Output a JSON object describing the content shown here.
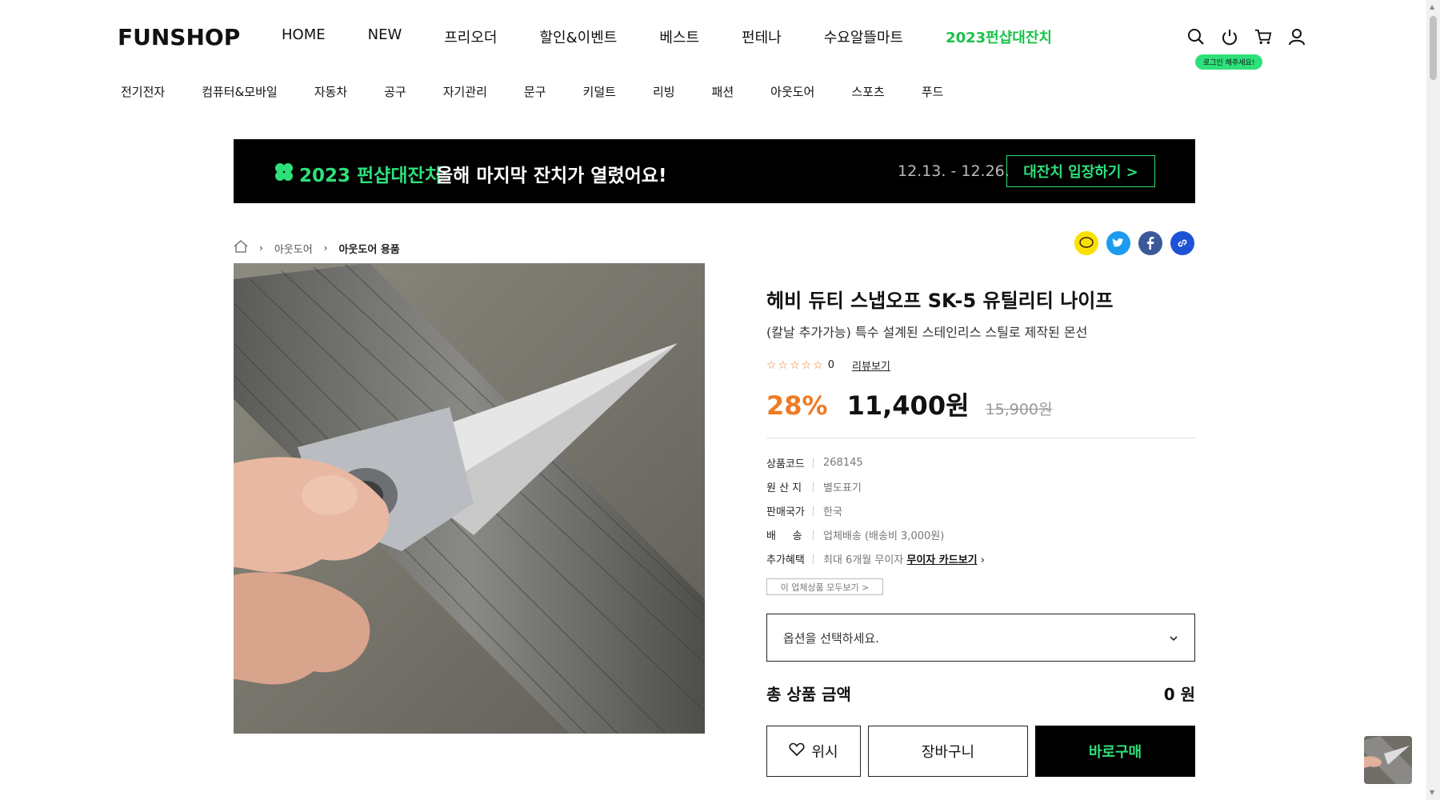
{
  "header": {
    "logo": "FUNSHOP",
    "nav": [
      "HOME",
      "NEW",
      "프리오더",
      "할인&이벤트",
      "베스트",
      "펀테나",
      "수요알뜰마트",
      "2023펀샵대잔치"
    ],
    "login_hint": "로그인 해주세요!",
    "icons": [
      "search-icon",
      "power-icon",
      "cart-icon",
      "user-icon"
    ]
  },
  "categories": [
    "전기전자",
    "컴퓨터&모바일",
    "자동차",
    "공구",
    "자기관리",
    "문구",
    "키덜트",
    "리빙",
    "패션",
    "아웃도어",
    "스포츠",
    "푸드"
  ],
  "banner": {
    "title": "2023 펀샵대잔치",
    "subtitle": "올해 마지막 잔치가 열렸어요!",
    "date": "12.13. - 12.26.",
    "button": "대잔치 입장하기 >"
  },
  "breadcrumb": {
    "level1": "아웃도어",
    "level2": "아웃도어 용품"
  },
  "product": {
    "name": "헤비 듀티 스냅오프 SK-5 유틸리티 나이프",
    "desc": "(칼날 추가가능) 특수 설계된 스테인리스 스틸로 제작된 몬선",
    "stars": "☆☆☆☆☆",
    "review_count": "0",
    "review_link": "리뷰보기",
    "discount": "28%",
    "price": "11,400원",
    "original_price": "15,900원",
    "specs": [
      {
        "k": "상품코드",
        "v": "268145"
      },
      {
        "k": "원 산 지",
        "v": "별도표기"
      },
      {
        "k": "판매국가",
        "v": "한국"
      },
      {
        "k": "배     송",
        "v": "업체배송 (배송비 3,000원)"
      },
      {
        "k": "추가혜택",
        "v": "최대 6개월 무이자 ",
        "link": "무이자 카드보기"
      }
    ],
    "vendor_button": "이 업체상품 모두보기 >",
    "option_placeholder": "옵션을 선택하세요.",
    "total_label": "총 상품 금액",
    "total_value": "0 원",
    "wish": "위시",
    "cart": "장바구니",
    "buy": "바로구매"
  },
  "colors": {
    "accent_green": "#2ee07a",
    "discount_orange": "#f07a23"
  }
}
